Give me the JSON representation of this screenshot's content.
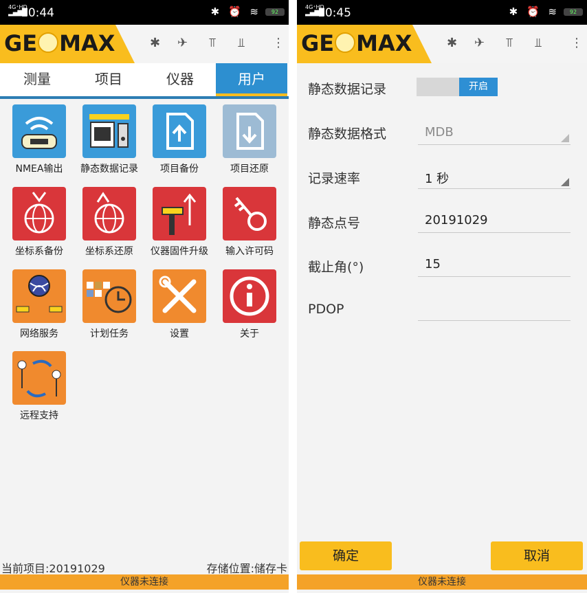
{
  "left": {
    "status": {
      "network": "4G⁺HD",
      "time": "10:44",
      "icons": "✱ ⏰ ≋",
      "battery": "92"
    },
    "app": {
      "logo": "GEMAX",
      "appbar_icons": [
        "bluetooth-icon",
        "satellite-icon",
        "antenna-icon",
        "rover-icon",
        "more-icon"
      ]
    },
    "tabs": [
      "测量",
      "项目",
      "仪器",
      "用户"
    ],
    "active_tab": "用户",
    "grid": [
      {
        "label": "NMEA输出",
        "icon": "nmea-output-icon",
        "color": "#3a9bd9"
      },
      {
        "label": "静态数据记录",
        "icon": "static-data-icon",
        "color": "#3a9bd9"
      },
      {
        "label": "项目备份",
        "icon": "project-backup-icon",
        "color": "#3a9bd9"
      },
      {
        "label": "项目还原",
        "icon": "project-restore-icon",
        "color": "#9dbbd4"
      },
      {
        "label": "坐标系备份",
        "icon": "coord-backup-icon",
        "color": "#d9363a"
      },
      {
        "label": "坐标系还原",
        "icon": "coord-restore-icon",
        "color": "#d9363a"
      },
      {
        "label": "仪器固件升级",
        "icon": "firmware-upgrade-icon",
        "color": "#d9363a"
      },
      {
        "label": "输入许可码",
        "icon": "license-key-icon",
        "color": "#d9363a"
      },
      {
        "label": "网络服务",
        "icon": "network-service-icon",
        "color": "#f08a2e"
      },
      {
        "label": "计划任务",
        "icon": "scheduled-task-icon",
        "color": "#f08a2e"
      },
      {
        "label": "设置",
        "icon": "settings-tools-icon",
        "color": "#f08a2e"
      },
      {
        "label": "关于",
        "icon": "about-info-icon",
        "color": "#f08a2e"
      },
      {
        "label": "远程支持",
        "icon": "remote-support-icon",
        "color": "#f08a2e"
      }
    ],
    "footer": {
      "project": "当前项目:20191029",
      "storage": "存储位置:储存卡"
    },
    "connection": "仪器未连接"
  },
  "right": {
    "status": {
      "network": "4G⁺HD",
      "time": "10:45",
      "icons": "✱ ⏰ ≋",
      "battery": "92"
    },
    "app": {
      "logo": "GEMAX"
    },
    "form": {
      "static_record_label": "静态数据记录",
      "static_record_toggle": "开启",
      "format_label": "静态数据格式",
      "format_value": "MDB",
      "rate_label": "记录速率",
      "rate_value": "1 秒",
      "point_label": "静态点号",
      "point_value": "20191029",
      "cutoff_label": "截止角(°)",
      "cutoff_value": "15",
      "pdop_label": "PDOP",
      "pdop_value": ""
    },
    "buttons": {
      "confirm": "确定",
      "cancel": "取消"
    },
    "connection": "仪器未连接"
  }
}
